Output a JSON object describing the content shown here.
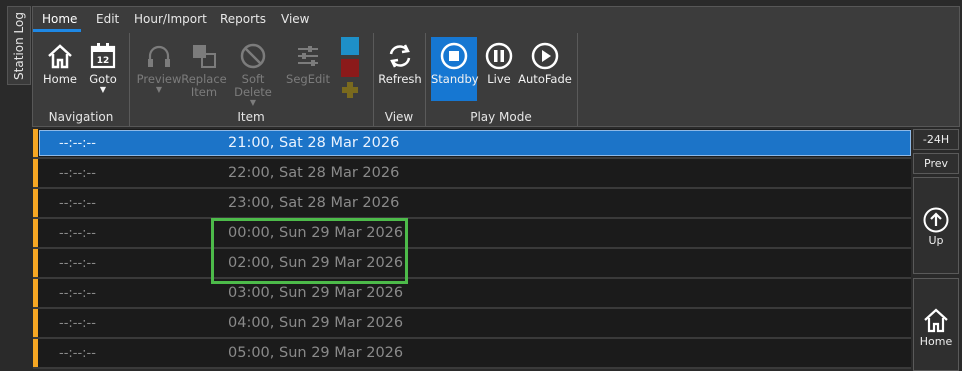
{
  "side_tab": {
    "label": "Station Log"
  },
  "menu": {
    "items": [
      "Home",
      "Edit",
      "Hour/Import",
      "Reports",
      "View"
    ],
    "active": "Home"
  },
  "ribbon": {
    "groups": {
      "navigation": {
        "title": "Navigation",
        "home_label": "Home",
        "goto_label": "Goto",
        "goto_day": "12"
      },
      "item": {
        "title": "Item",
        "preview_label": "Preview",
        "replace_label": "Replace\nItem",
        "soft_delete_label": "Soft\nDelete",
        "segedit_label": "SegEdit"
      },
      "view": {
        "title": "View",
        "refresh_label": "Refresh"
      },
      "play_mode": {
        "title": "Play Mode",
        "standby_label": "Standby",
        "live_label": "Live",
        "autofade_label": "AutoFade"
      }
    },
    "swatch_colors": [
      "#1e90c8",
      "#8b1a1a",
      "#7a6a1e"
    ]
  },
  "log_rows": [
    {
      "time": "--:--:--",
      "header": "21:00, Sat 28 Mar 2026",
      "selected": true
    },
    {
      "time": "--:--:--",
      "header": "22:00, Sat 28 Mar 2026"
    },
    {
      "time": "--:--:--",
      "header": "23:00, Sat 28 Mar 2026"
    },
    {
      "time": "--:--:--",
      "header": "00:00, Sun 29 Mar 2026"
    },
    {
      "time": "--:--:--",
      "header": "02:00, Sun 29 Mar 2026"
    },
    {
      "time": "--:--:--",
      "header": "03:00, Sun 29 Mar 2026"
    },
    {
      "time": "--:--:--",
      "header": "04:00, Sun 29 Mar 2026"
    },
    {
      "time": "--:--:--",
      "header": "05:00, Sun 29 Mar 2026"
    }
  ],
  "right_panel": {
    "minus24_label": "-24H",
    "prev_label": "Prev",
    "up_label": "Up",
    "home_label": "Home"
  },
  "colors": {
    "accent": "#1677d2",
    "highlight_box": "#4dbb4a",
    "row_marker": "#f5a623"
  }
}
